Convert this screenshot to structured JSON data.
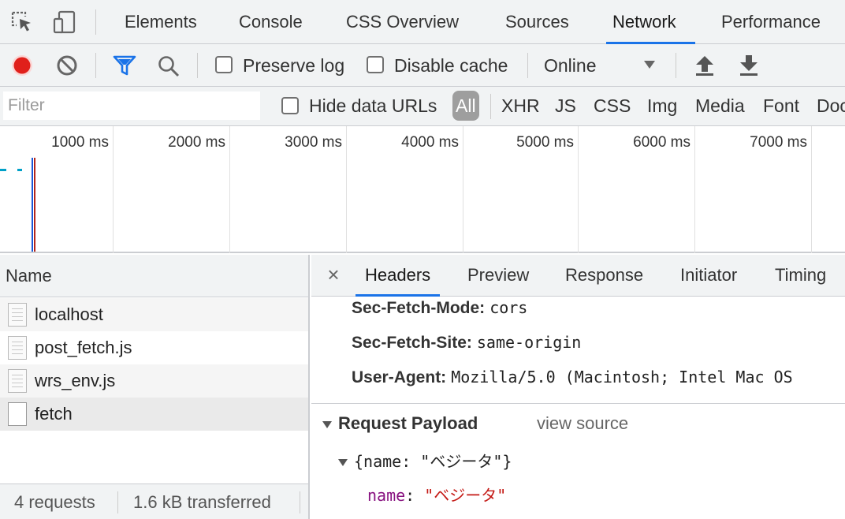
{
  "tabs": [
    "Elements",
    "Console",
    "CSS Overview",
    "Sources",
    "Network",
    "Performance"
  ],
  "active_tab": "Network",
  "toolbar": {
    "preserve_log": "Preserve log",
    "disable_cache": "Disable cache",
    "throttling": "Online"
  },
  "filter": {
    "placeholder": "Filter",
    "hide_data_urls": "Hide data URLs",
    "types": [
      "All",
      "XHR",
      "JS",
      "CSS",
      "Img",
      "Media",
      "Font",
      "Doc"
    ]
  },
  "timeline": {
    "ticks": [
      "1000 ms",
      "2000 ms",
      "3000 ms",
      "4000 ms",
      "5000 ms",
      "6000 ms",
      "7000 ms"
    ]
  },
  "requests": {
    "column": "Name",
    "rows": [
      "localhost",
      "post_fetch.js",
      "wrs_env.js",
      "fetch"
    ],
    "status_count": "4 requests",
    "status_transferred": "1.6 kB transferred"
  },
  "detail": {
    "close": "×",
    "tabs": [
      "Headers",
      "Preview",
      "Response",
      "Initiator",
      "Timing"
    ],
    "headers": [
      {
        "key": "Sec-Fetch-Mode:",
        "value": "cors"
      },
      {
        "key": "Sec-Fetch-Site:",
        "value": "same-origin"
      },
      {
        "key": "User-Agent:",
        "value": "Mozilla/5.0 (Macintosh; Intel Mac OS"
      }
    ],
    "payload_title": "Request Payload",
    "view_source": "view source",
    "payload_summary": "{name: \"ベジータ\"}",
    "payload_key": "name",
    "payload_colon": ":",
    "payload_value": "\"ベジータ\""
  },
  "colors": {
    "accent": "#1a73e8",
    "record": "#e0201b",
    "filter_icon": "#1a73e8"
  }
}
